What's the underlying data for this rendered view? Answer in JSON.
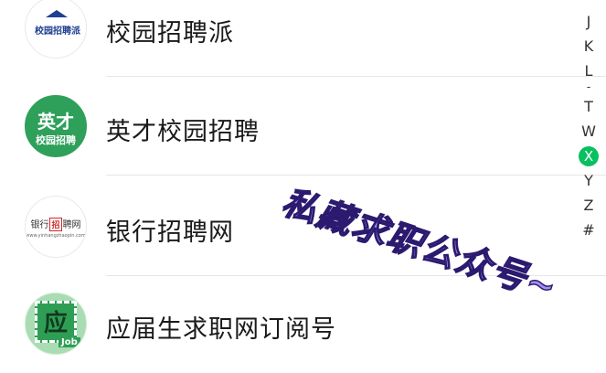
{
  "contacts": [
    {
      "name": "校园招聘派",
      "avatar_text": "校园招聘派"
    },
    {
      "name": "英才校园招聘",
      "avatar_line1": "英才",
      "avatar_line2": "校园招聘"
    },
    {
      "name": "银行招聘网",
      "avatar_brand_a": "银行",
      "avatar_brand_b": "招",
      "avatar_brand_c": "聘网",
      "avatar_url": "www.yinhangzhaopin.com"
    },
    {
      "name": "应届生求职网订阅号",
      "avatar_char": "应",
      "avatar_badge": "Job"
    }
  ],
  "index_bar": [
    "J",
    "K",
    "L",
    "-",
    "T",
    "W",
    "X",
    "Y",
    "Z",
    "#"
  ],
  "index_active": "X",
  "watermark": "私藏求职公众号~",
  "colors": {
    "accent": "#07c160",
    "watermark_fill": "#a78ef0",
    "watermark_stroke": "#2b1a6f"
  }
}
